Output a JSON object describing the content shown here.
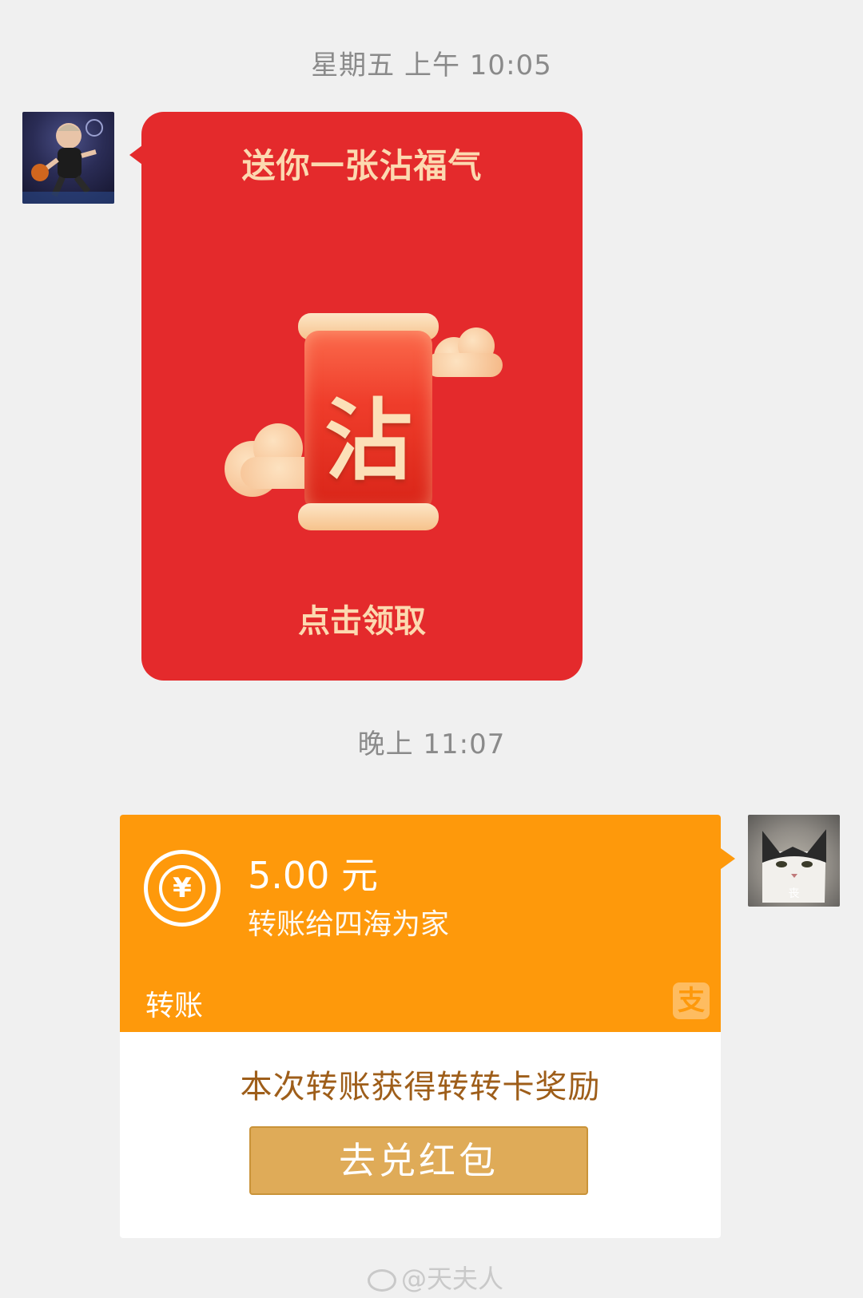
{
  "messages": {
    "time1": "星期五 上午 10:05",
    "time2": "晚上 11:07"
  },
  "red_packet": {
    "title": "送你一张沾福气",
    "character": "沾",
    "cta": "点击领取"
  },
  "transfer": {
    "amount": "5.00 元",
    "recipient": "转账给四海为家",
    "label": "转账",
    "currency_icon": "¥",
    "alipay_glyph": "支",
    "reward_text": "本次转账获得转转卡奖励",
    "button_label": "去兑红包"
  },
  "avatars": {
    "right_caption": "丧"
  },
  "watermark": "@天夫人",
  "colors": {
    "red_packet": "#e42a2c",
    "transfer_orange": "#fe990b",
    "button_gold": "#dfab58"
  }
}
